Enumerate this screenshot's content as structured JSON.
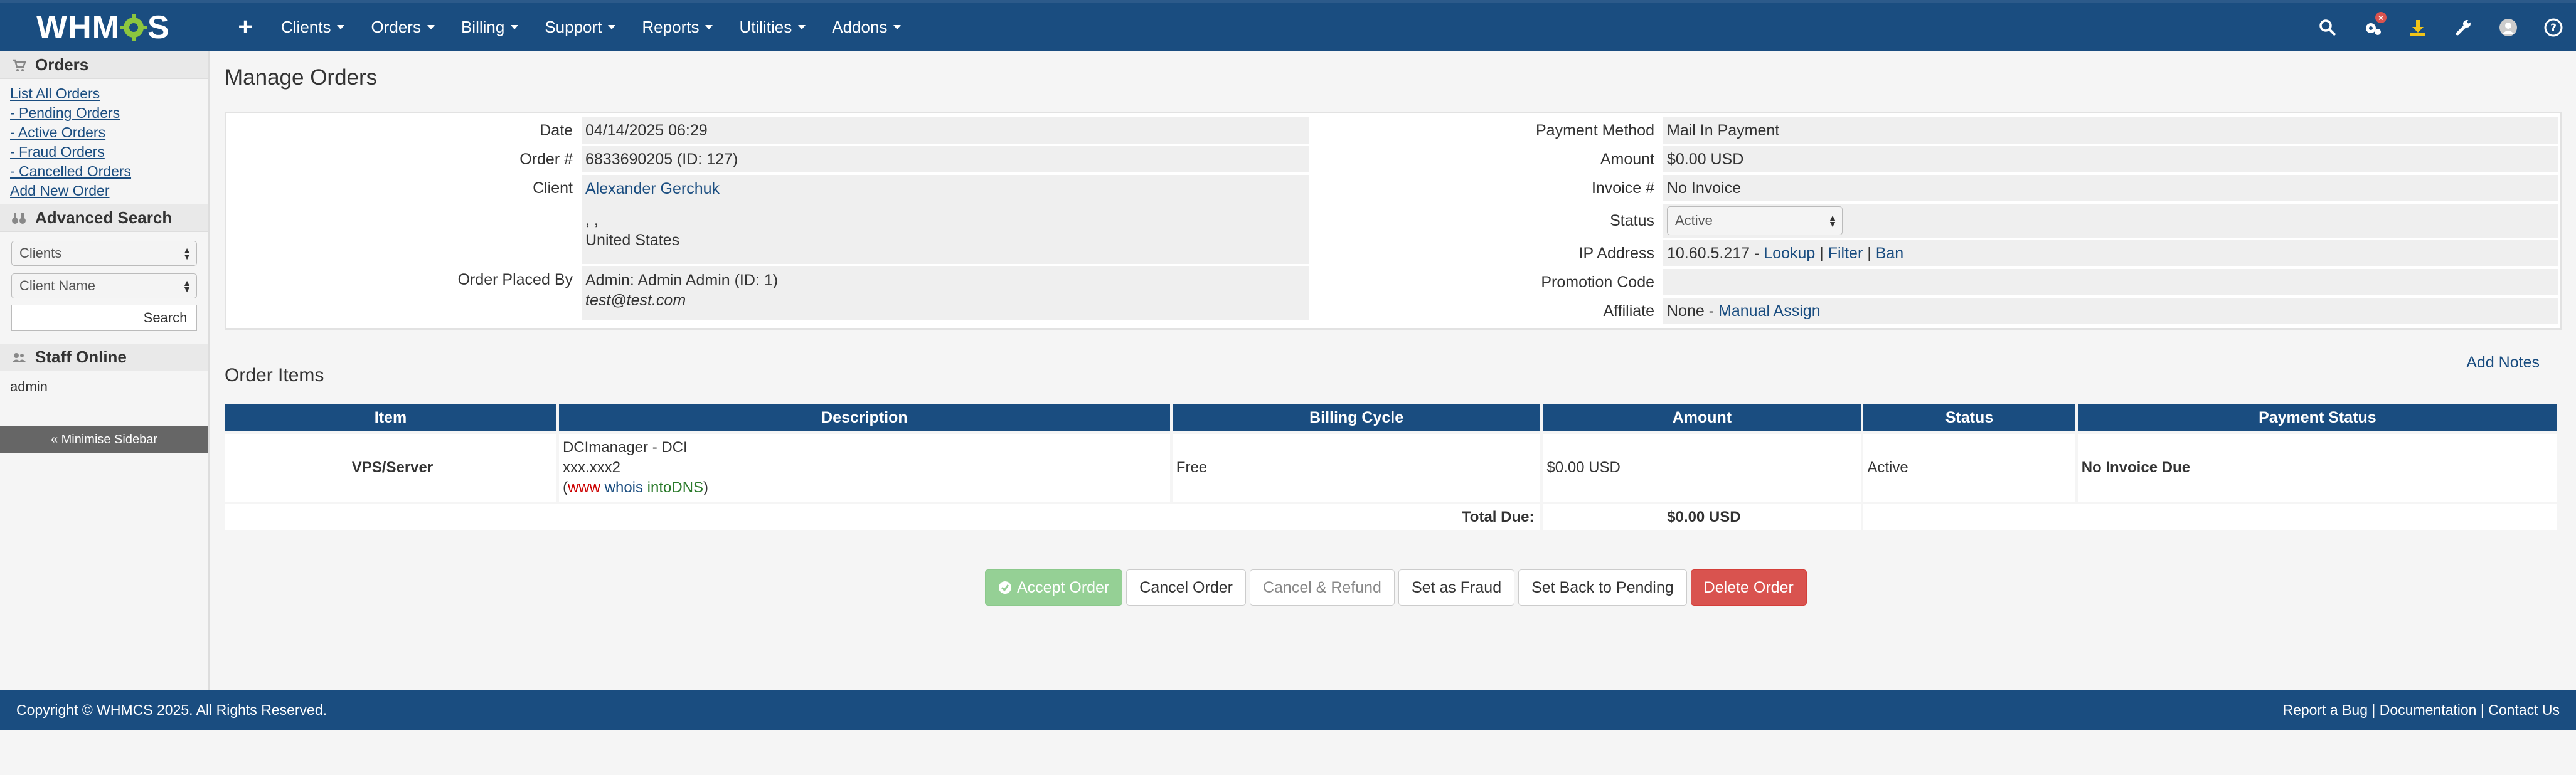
{
  "brand": "WHMCS",
  "colors": {
    "primary": "#1a4d80",
    "accept": "#95d095",
    "danger": "#d9534f",
    "no_invoice": "#779500"
  },
  "nav": {
    "plus": "+",
    "items": [
      "Clients",
      "Orders",
      "Billing",
      "Support",
      "Reports",
      "Utilities",
      "Addons"
    ],
    "right_icons": [
      "search-icon",
      "gears-icon",
      "download-icon",
      "wrench-icon",
      "avatar-icon",
      "help-icon"
    ],
    "badge": "×"
  },
  "sidebar": {
    "orders_title": "Orders",
    "links": [
      "List All Orders",
      "- Pending Orders",
      "- Active Orders",
      "- Fraud Orders",
      "- Cancelled Orders",
      "Add New Order"
    ],
    "advanced_title": "Advanced Search",
    "select1": "Clients",
    "select2": "Client Name",
    "search_button": "Search",
    "staff_title": "Staff Online",
    "staff": "admin",
    "minimise": "« Minimise Sidebar"
  },
  "page": {
    "title": "Manage Orders"
  },
  "order": {
    "date_label": "Date",
    "date": "04/14/2025 06:29",
    "order_label": "Order #",
    "order_num": "6833690205 (ID: 127)",
    "client_label": "Client",
    "client_name": "Alexander Gerchuk",
    "client_addr": ", ,",
    "client_country": "United States",
    "placed_label": "Order Placed By",
    "placed_by": "Admin: Admin Admin (ID: 1)",
    "placed_email": "test@test.com",
    "payment_label": "Payment Method",
    "payment": "Mail In Payment",
    "amount_label": "Amount",
    "amount": "$0.00 USD",
    "invoice_label": "Invoice #",
    "invoice": "No Invoice",
    "status_label": "Status",
    "status": "Active",
    "ip_label": "IP Address",
    "ip": "10.60.5.217 -",
    "ip_lookup": "Lookup",
    "ip_sep": "|",
    "ip_filter": "Filter",
    "ip_ban": "Ban",
    "promo_label": "Promotion Code",
    "promo": "",
    "affiliate_label": "Affiliate",
    "affiliate": "None -",
    "affiliate_link": "Manual Assign"
  },
  "items": {
    "title": "Order Items",
    "add_notes": "Add Notes",
    "headers": [
      "Item",
      "Description",
      "Billing Cycle",
      "Amount",
      "Status",
      "Payment Status"
    ],
    "row": {
      "item": "VPS/Server",
      "desc1": "DCImanager - DCI",
      "desc2": "xxx.xxx2",
      "www": "www",
      "whois": "whois",
      "intodns": "intoDNS",
      "cycle": "Free",
      "amount": "$0.00 USD",
      "status": "Active",
      "payment_status": "No Invoice Due"
    },
    "total_label": "Total Due:",
    "total": "$0.00 USD"
  },
  "actions": [
    "Accept Order",
    "Cancel Order",
    "Cancel & Refund",
    "Set as Fraud",
    "Set Back to Pending",
    "Delete Order"
  ],
  "footer": {
    "copyright": "Copyright © WHMCS 2025. All Rights Reserved.",
    "links": [
      "Report a Bug",
      "Documentation",
      "Contact Us"
    ]
  }
}
